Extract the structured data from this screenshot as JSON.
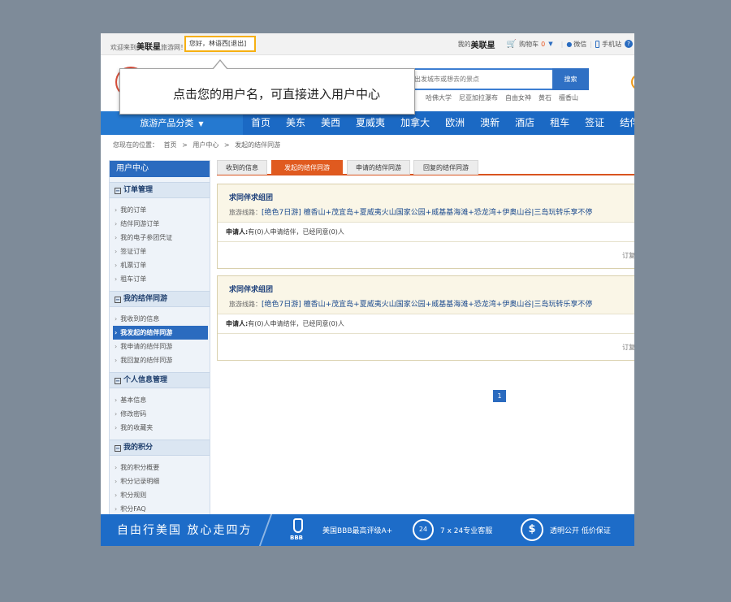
{
  "topbar": {
    "welcome_prefix": "欢迎来到",
    "brand": "美联星",
    "welcome_suffix": "旅游网！",
    "user_greeting": "您好，林语西[退出]",
    "right_prefix": "我的",
    "right_brand": "美联星",
    "cart_label": "购物车",
    "cart_count": "0",
    "wechat": "微信",
    "mobile": "手机站",
    "help": "?"
  },
  "header": {
    "search_placeholder": "出发城市或想去的景点",
    "search_button": "搜索",
    "hot_words": [
      "哈佛大学",
      "尼亚加拉瀑布",
      "自由女神",
      "黄石",
      "檀香山"
    ]
  },
  "nav": {
    "category": "旅游产品分类",
    "links": [
      "首页",
      "美东",
      "美西",
      "夏威夷",
      "加拿大",
      "欧洲",
      "澳新",
      "酒店",
      "租车",
      "签证",
      "结伴同游"
    ]
  },
  "breadcrumb": [
    "您现在的位置：",
    "首页",
    ">",
    "用户中心",
    ">",
    "发起的结伴同游"
  ],
  "sidebar": {
    "title": "用户中心",
    "sections": [
      {
        "title": "订单管理",
        "items": [
          "我的订单",
          "结伴同游订单",
          "我的电子参团凭证",
          "签证订单",
          "机票订单",
          "租车订单"
        ]
      },
      {
        "title": "我的结伴同游",
        "items": [
          "我收到的信息",
          "我发起的结伴同游",
          "我申请的结伴同游",
          "我回复的结伴同游"
        ]
      },
      {
        "title": "个人信息管理",
        "items": [
          "基本信息",
          "修改密码",
          "我的收藏夹"
        ]
      },
      {
        "title": "我的积分",
        "items": [
          "我的积分概要",
          "积分记录明细",
          "积分规则",
          "积分FAQ"
        ]
      }
    ]
  },
  "tabs": [
    "收到的信息",
    "发起的结伴同游",
    "申请的结伴同游",
    "回复的结伴同游"
  ],
  "posts": [
    {
      "title": "求同伴求组团",
      "route_label": "旅游线路：",
      "route": "[绝色7日游] 檀香山+茂宜岛+夏威夷火山国家公园+威基基海滩+恐龙湾+伊奥山谷|三岛玩转乐享不停",
      "apply_label": "申请人:",
      "apply_text": "有(0)人申请结伴，已经同意(0)人",
      "order": "订复"
    },
    {
      "title": "求同伴求组团",
      "route_label": "旅游线路：",
      "route": "[绝色7日游] 檀香山+茂宜岛+夏威夷火山国家公园+威基基海滩+恐龙湾+伊奥山谷|三岛玩转乐享不停",
      "apply_label": "申请人:",
      "apply_text": "有(0)人申请结伴，已经同意(0)人",
      "order": "订复"
    }
  ],
  "pager": {
    "current": "1"
  },
  "footer": {
    "slogan": "自由行美国  放心走四方",
    "bbb": "BBB",
    "bbb_text": "美国BBB最高评级A+",
    "service_icon": "24",
    "service_text": "7 x 24专业客服",
    "price_icon": "$",
    "price_text": "透明公开 低价保证"
  },
  "callout": {
    "text": "点击您的用户名，可直接进入用户中心"
  },
  "colors": {
    "accent_blue": "#1b69c4",
    "tab_active": "#e05a1f",
    "highlight_border": "#f6b012",
    "overlay_bg": "#7e8b99"
  }
}
